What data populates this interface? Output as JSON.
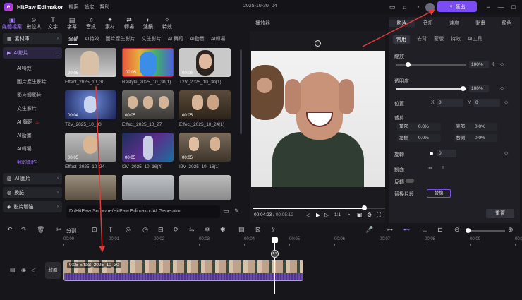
{
  "app": {
    "name": "HitPaw Edimakor",
    "menu": [
      "檔案",
      "設定",
      "幫助"
    ],
    "doc_title": "2025-10-30_04",
    "export_label": "匯出"
  },
  "toolbar": [
    "媒體檔案",
    "數位人",
    "文字",
    "字幕",
    "音訊",
    "素材",
    "轉場",
    "濾鏡",
    "特效"
  ],
  "sidebar": {
    "top_items": [
      {
        "label": "素材庫"
      },
      {
        "label": "AI影片"
      }
    ],
    "sub_items": [
      "AI特效",
      "圖片產生影片",
      "影片轉影片",
      "文生影片",
      "AI 舞蹈",
      "AI動畫",
      "AI轉場",
      "我的創作"
    ],
    "bottom_items": [
      {
        "label": "AI 圖片"
      },
      {
        "label": "換臉"
      },
      {
        "label": "影片增強"
      }
    ]
  },
  "media": {
    "tabs": [
      "全部",
      "AI特效",
      "圖片產生影片",
      "文生影片",
      "AI 舞蹈",
      "AI動畫",
      "AI轉場"
    ],
    "cards": [
      {
        "dur": "00:05",
        "name": "Effect_2025_10_30"
      },
      {
        "dur": "00:05",
        "name": "Restyle_2025_10_30(1)"
      },
      {
        "dur": "00:06",
        "name": "T2V_2025_10_30(1)"
      },
      {
        "dur": "00:04",
        "name": "T2V_2025_10_30"
      },
      {
        "dur": "00:05",
        "name": "Effect_2025_10_27"
      },
      {
        "dur": "00:05",
        "name": "Effect_2025_10_24(1)"
      },
      {
        "dur": "00:05",
        "name": "Effect_2025_10_24"
      },
      {
        "dur": "00:05",
        "name": "I2V_2025_10_16(4)"
      },
      {
        "dur": "00:05",
        "name": "I2V_2025_10_16(1)"
      },
      {
        "dur": "",
        "name": ""
      },
      {
        "dur": "",
        "name": ""
      },
      {
        "dur": "",
        "name": ""
      }
    ],
    "path": "D:/HitPaw Software/HitPaw Edimakor/AI Generator"
  },
  "preview": {
    "header": "播放器",
    "time_current": "00:04:23",
    "time_total": "00:05:12",
    "ratio": "1:1",
    "progress": 0.84
  },
  "inspector": {
    "tabs": [
      "影片",
      "音訊",
      "速度",
      "動畫",
      "顏色"
    ],
    "subtabs": [
      "常用",
      "去背",
      "蒙版",
      "特效",
      "AI工具"
    ],
    "scale_label": "縮放",
    "scale_value": "100%",
    "opacity_label": "透明度",
    "opacity_value": "100%",
    "position_label": "位置",
    "pos_x_label": "X",
    "pos_x": "0",
    "pos_y_label": "Y",
    "pos_y": "0",
    "crop_label": "裁剪",
    "crop_top": "頂部",
    "crop_top_val": "0.0%",
    "crop_bottom": "底部",
    "crop_bottom_val": "0.0%",
    "crop_left": "左側",
    "crop_left_val": "0.0%",
    "crop_right": "右側",
    "crop_right_val": "0.0%",
    "rotate_label": "旋轉",
    "rotate_value": "0",
    "mirror_label": "鏡面",
    "reverse_label": "反轉",
    "replace_label": "替換片段",
    "replace_btn": "替換",
    "reset_label": "重置"
  },
  "timeline": {
    "split_label": "分割",
    "cover_label": "封面",
    "clip_label": "0:05 Effect_2025_10_30",
    "ruler_marks": [
      "00:00",
      "00:01",
      "00:02",
      "00:03",
      "00:04",
      "00:05",
      "00:06",
      "00:07",
      "00:08",
      "00:09",
      "00:10"
    ]
  },
  "colors": {
    "accent": "#7b4cf6",
    "annotation": "#e53a3a"
  }
}
